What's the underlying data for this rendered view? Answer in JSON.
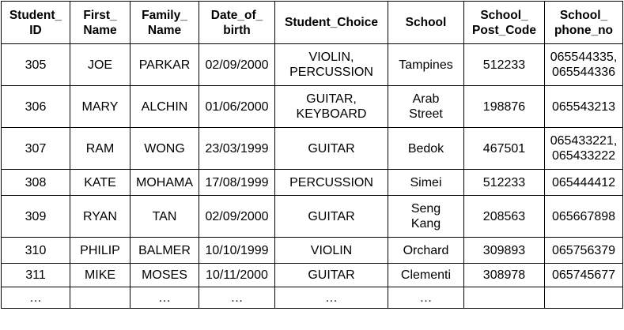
{
  "columns": [
    "Student_\nID",
    "First_\nName",
    "Family_\nName",
    "Date_of_\nbirth",
    "Student_Choice",
    "School",
    "School_\nPost_Code",
    "School_\nphone_no"
  ],
  "rows": [
    [
      "305",
      "JOE",
      "PARKAR",
      "02/09/2000",
      "VIOLIN,\nPERCUSSION",
      "Tampines",
      "512233",
      "065544335,\n065544336"
    ],
    [
      "306",
      "MARY",
      "ALCHIN",
      "01/06/2000",
      "GUITAR,\nKEYBOARD",
      "Arab\nStreet",
      "198876",
      "065543213"
    ],
    [
      "307",
      "RAM",
      "WONG",
      "23/03/1999",
      "GUITAR",
      "Bedok",
      "467501",
      "065433221,\n065433222"
    ],
    [
      "308",
      "KATE",
      "MOHAMA",
      "17/08/1999",
      "PERCUSSION",
      "Simei",
      "512233",
      "065444412"
    ],
    [
      "309",
      "RYAN",
      "TAN",
      "02/09/2000",
      "GUITAR",
      "Seng\nKang",
      "208563",
      "065667898"
    ],
    [
      "310",
      "PHILIP",
      "BALMER",
      "10/10/1999",
      "VIOLIN",
      "Orchard",
      "309893",
      "065756379"
    ],
    [
      "311",
      "MIKE",
      "MOSES",
      "10/11/2000",
      "GUITAR",
      "Clementi",
      "308978",
      "065745677"
    ],
    [
      "…",
      "",
      "…",
      "…",
      "…",
      "…",
      "",
      ""
    ]
  ]
}
